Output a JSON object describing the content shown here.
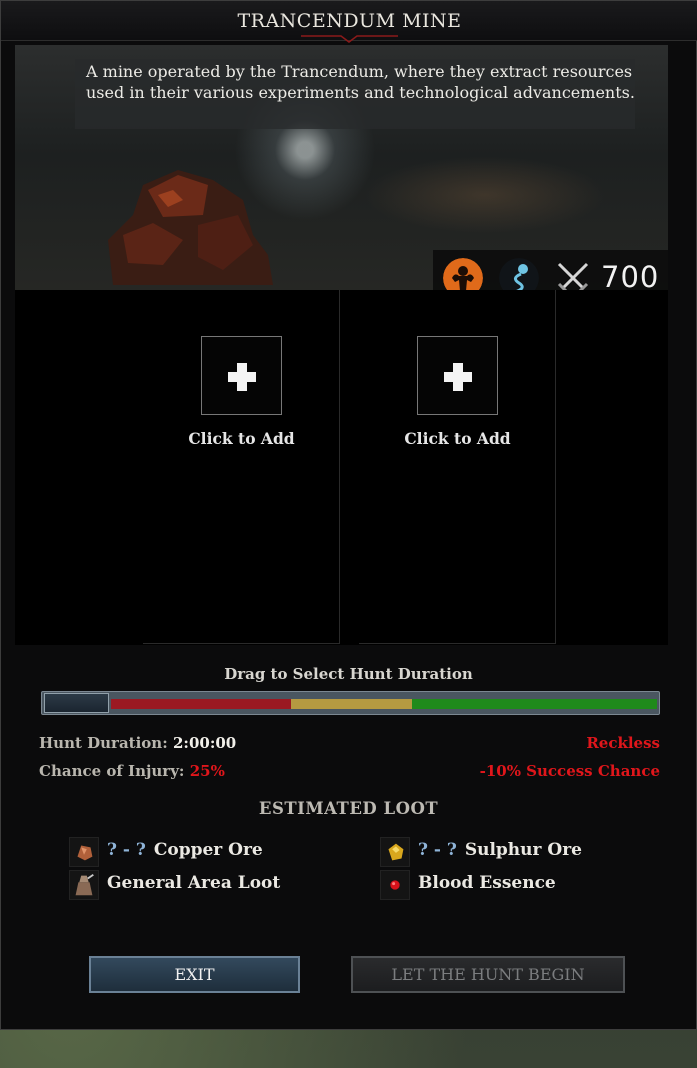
{
  "window": {
    "title": "TRANCENDUM MINE",
    "description": "A mine operated by the Trancendum, where they extract resources used in their various experiments and technological advancements."
  },
  "requirements": {
    "icons": [
      "strength-flexing-icon",
      "blue-serpent-icon",
      "crossed-swords-icon"
    ],
    "power_value": "700"
  },
  "slots": [
    {
      "label": "Click to Add"
    },
    {
      "label": "Click to Add"
    }
  ],
  "duration": {
    "drag_label": "Drag to Select Hunt Duration",
    "slider_position_fraction": 0,
    "segment_colors": [
      "#9b1922",
      "#b59a41",
      "#1f8a1b"
    ],
    "hunt_duration_label": "Hunt Duration:",
    "hunt_duration_value": "2:00:00",
    "injury_label": "Chance of Injury:",
    "injury_value": "25%",
    "mode": "Reckless",
    "success_modifier": "-10% Success Chance"
  },
  "loot": {
    "heading": "ESTIMATED LOOT",
    "items": [
      {
        "range": "? - ?",
        "name": "Copper Ore",
        "icon": "copper-ore-icon"
      },
      {
        "range": "? - ?",
        "name": "Sulphur Ore",
        "icon": "sulphur-ore-icon"
      },
      {
        "range": "",
        "name": "General Area Loot",
        "icon": "loot-sack-icon"
      },
      {
        "range": "",
        "name": "Blood Essence",
        "icon": "blood-essence-icon"
      }
    ]
  },
  "buttons": {
    "exit": "EXIT",
    "begin": "LET THE HUNT BEGIN"
  },
  "colors": {
    "accent_red": "#e0161b",
    "range_blue": "#8fb4d8"
  }
}
